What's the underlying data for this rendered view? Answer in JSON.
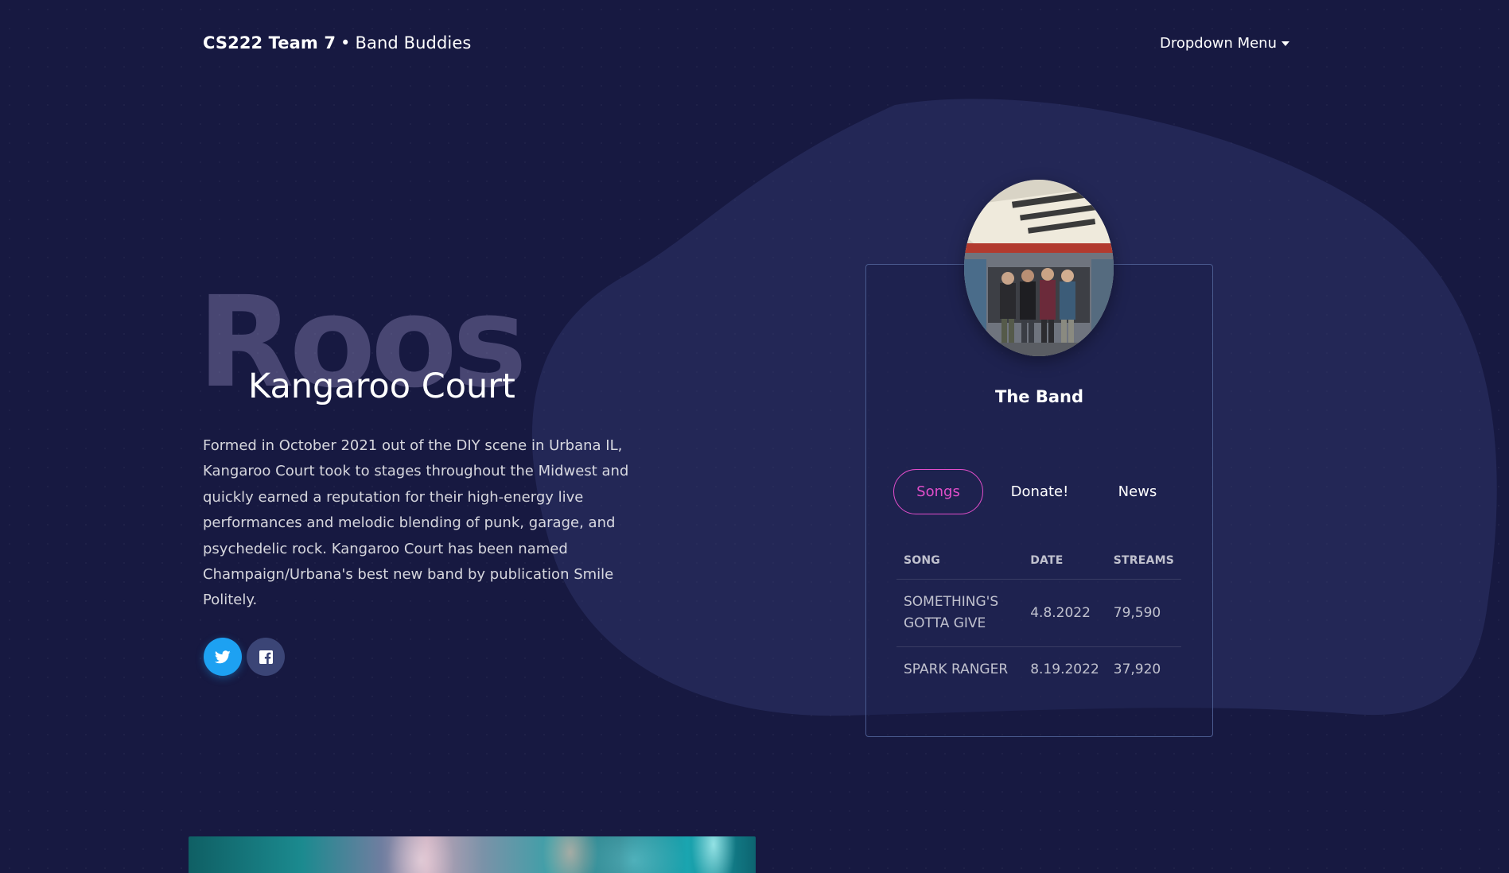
{
  "navbar": {
    "brand_team": "CS222 Team 7",
    "brand_separator": "•",
    "brand_sub": "Band Buddies",
    "dropdown_label": "Dropdown Menu",
    "dropdown_icon": "caret-down-icon"
  },
  "hero": {
    "background_word": "Roos",
    "title": "Kangaroo Court",
    "description": "Formed in October 2021 out of the DIY scene in Urbana IL, Kangaroo Court took to stages throughout the Midwest and quickly earned a reputation for their high-energy live performances and melodic blending of punk, garage, and psychedelic rock. Kangaroo Court has been named Champaign/Urbana's best new band by publication Smile Politely."
  },
  "social": {
    "twitter_icon": "twitter-icon",
    "twitter_color": "#1da1f2",
    "facebook_icon": "facebook-icon",
    "facebook_color": "#3b4576"
  },
  "card": {
    "avatar_icon": "band-photo",
    "title": "The Band",
    "tabs": [
      {
        "label": "Songs",
        "active": true
      },
      {
        "label": "Donate!",
        "active": false
      },
      {
        "label": "News",
        "active": false
      }
    ],
    "table": {
      "headers": [
        "SONG",
        "DATE",
        "STREAMS"
      ],
      "rows": [
        {
          "song": "SOMETHING'S GOTTA GIVE",
          "date": "4.8.2022",
          "streams": "79,590"
        },
        {
          "song": "SPARK RANGER",
          "date": "8.19.2022",
          "streams": "37,920"
        }
      ]
    }
  },
  "colors": {
    "background": "#171941",
    "accent": "#e14eca",
    "card_border": "#4a5a8e"
  }
}
